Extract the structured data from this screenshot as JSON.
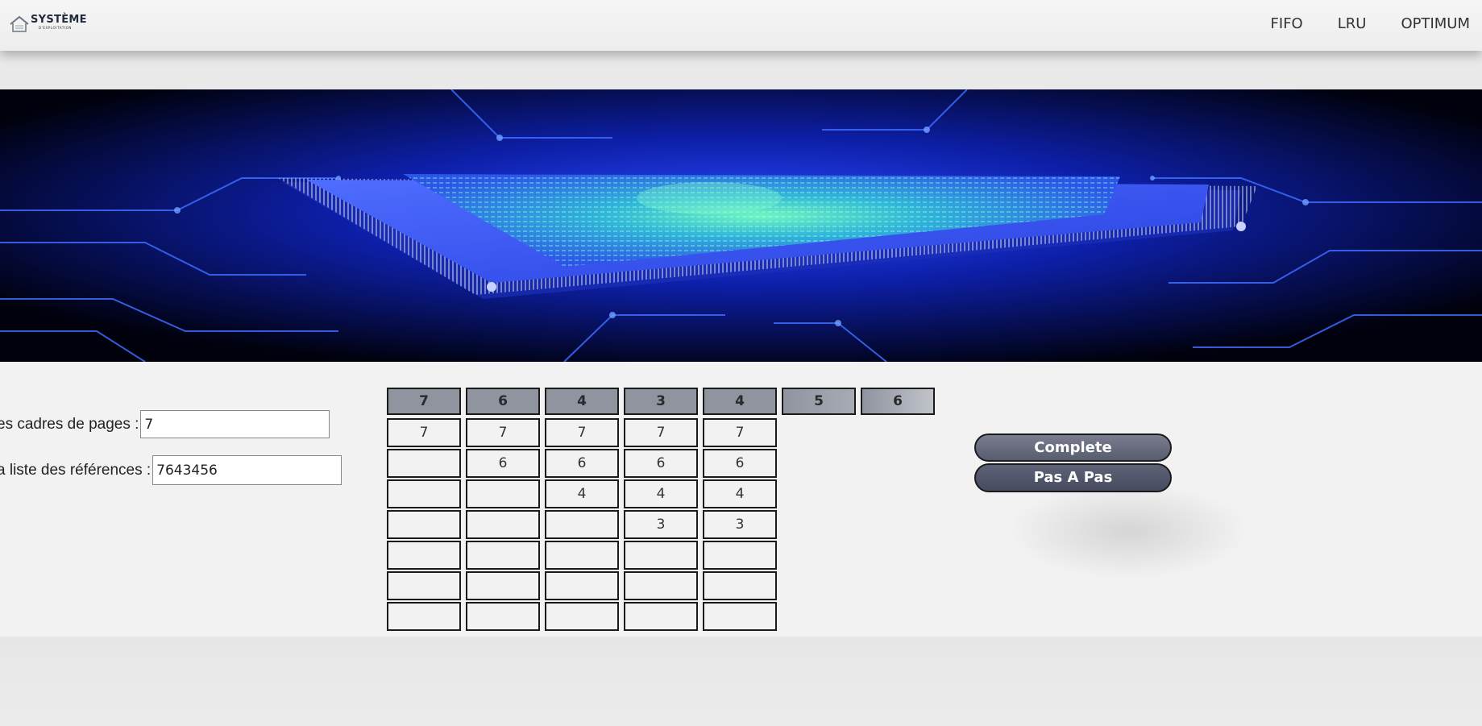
{
  "brand": {
    "title": "SYSTÈME",
    "subtitle": "D'EXPLOITATION"
  },
  "nav": {
    "links": [
      {
        "label": "FIFO"
      },
      {
        "label": "LRU"
      },
      {
        "label": "OPTIMUM"
      }
    ]
  },
  "hero": {
    "image": "circuit-board-cpu-chip",
    "colors": {
      "primary": "#1e3cff",
      "glow": "#3fe0b0",
      "background": "#000000"
    }
  },
  "form": {
    "frames_label": "es cadres de pages :",
    "frames_value": "7",
    "refs_label": "a liste des références :",
    "refs_value": "7643456"
  },
  "simulation": {
    "references": [
      "7",
      "6",
      "4",
      "3",
      "4",
      "5",
      "6"
    ],
    "rows": [
      [
        "7",
        "7",
        "7",
        "7",
        "7"
      ],
      [
        "",
        "6",
        "6",
        "6",
        "6"
      ],
      [
        "",
        "",
        "4",
        "4",
        "4"
      ],
      [
        "",
        "",
        "",
        "3",
        "3"
      ],
      [
        "",
        "",
        "",
        "",
        ""
      ],
      [
        "",
        "",
        "",
        "",
        ""
      ],
      [
        "",
        "",
        "",
        "",
        ""
      ]
    ]
  },
  "buttons": {
    "complete": "Complete",
    "step": "Pas A Pas"
  },
  "colors": {
    "ref_header": "#8f949f",
    "button": "#585c70",
    "page_background": "#f2f2f2"
  }
}
